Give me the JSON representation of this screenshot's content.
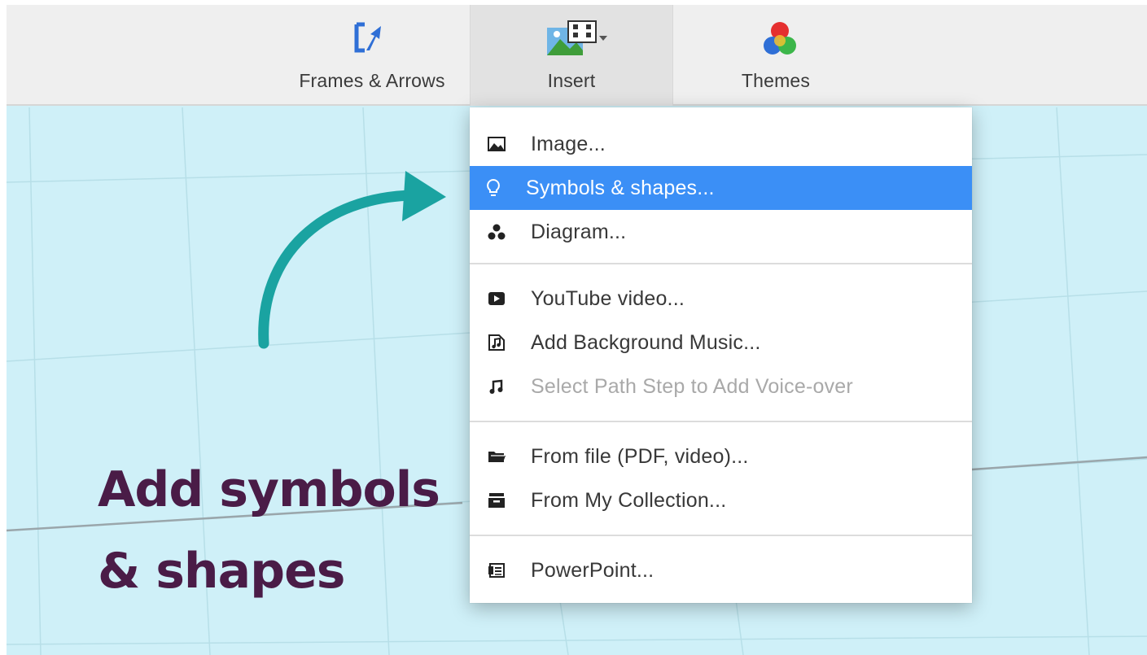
{
  "toolbar": {
    "items": [
      {
        "label": "Frames & Arrows",
        "icon": "frame-arrow-icon"
      },
      {
        "label": "Insert",
        "icon": "media-insert-icon"
      },
      {
        "label": "Themes",
        "icon": "themes-palette-icon"
      }
    ]
  },
  "canvas": {
    "headline_line1": "Add symbols",
    "headline_line2": "& shapes",
    "arrow_color": "#1aa3a1",
    "headline_color": "#4a1c47",
    "background_color": "#cff0f8"
  },
  "menu": {
    "items": [
      {
        "label": "Image...",
        "icon": "image-icon"
      },
      {
        "label": "Symbols & shapes...",
        "icon": "lightbulb-icon",
        "state": "highlighted"
      },
      {
        "label": "Diagram...",
        "icon": "diagram-icon"
      },
      {
        "label": "YouTube video...",
        "icon": "youtube-play-icon"
      },
      {
        "label": "Add Background Music...",
        "icon": "music-file-icon"
      },
      {
        "label": "Select Path Step to Add Voice-over",
        "icon": "music-note-icon",
        "state": "disabled"
      },
      {
        "label": "From file (PDF, video)...",
        "icon": "folder-icon"
      },
      {
        "label": "From My Collection...",
        "icon": "collection-box-icon"
      },
      {
        "label": "PowerPoint...",
        "icon": "powerpoint-icon"
      }
    ],
    "highlight_color": "#3b8ff6"
  }
}
